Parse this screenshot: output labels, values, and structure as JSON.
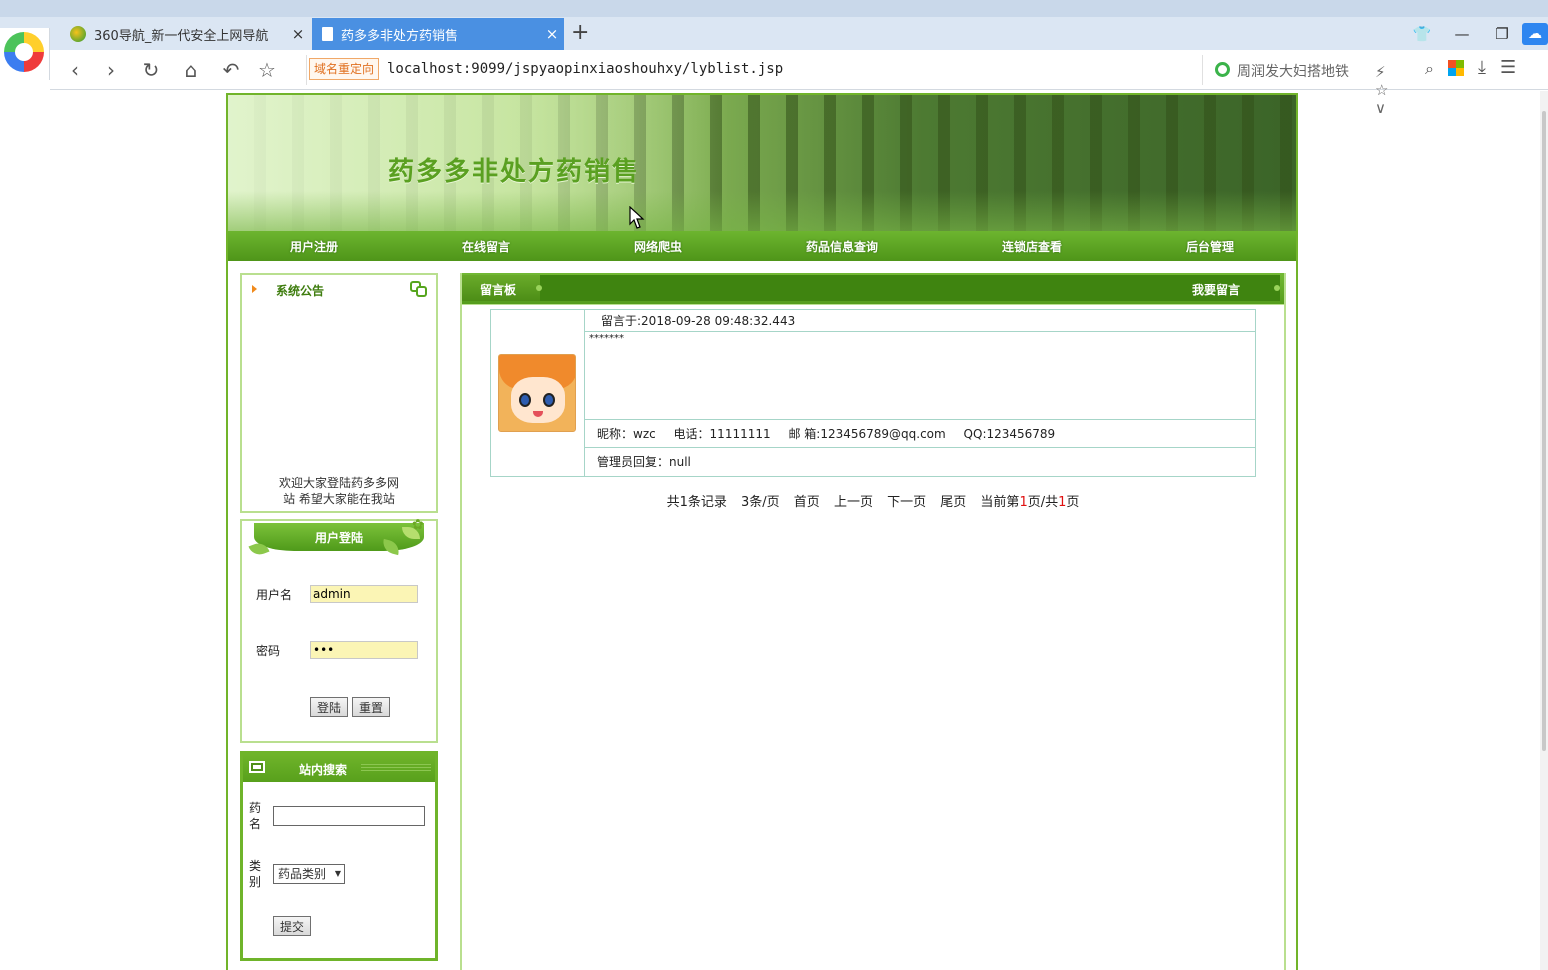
{
  "browser": {
    "tabs": [
      {
        "label": "360导航_新一代安全上网导航",
        "close": "×",
        "active": false
      },
      {
        "label": "药多多非处方药销售",
        "close": "×",
        "active": true
      }
    ],
    "new_tab": "+",
    "redirect_badge": "域名重定向",
    "url": "localhost:9099/jspyaopinxiaoshouhxy/lyblist.jsp",
    "search_placeholder": "周润发大妇搭地铁",
    "icons": [
      "back-icon",
      "forward-icon",
      "refresh-icon",
      "home-icon",
      "undo-icon",
      "star-icon",
      "lightning-icon",
      "dropdown-icon",
      "search-icon",
      "apps-icon",
      "download-icon",
      "menu-icon",
      "shirt-icon",
      "minimize-icon",
      "restore-icon",
      "cloud-icon"
    ]
  },
  "site": {
    "title": "药多多非处方药销售",
    "nav": [
      "用户注册",
      "在线留言",
      "网络爬虫",
      "药品信息查询",
      "连锁店查看",
      "后台管理"
    ]
  },
  "notice": {
    "title": "系统公告",
    "marquee_line1": "欢迎大家登陆药多多网",
    "marquee_line2": "站        希望大家能在我站"
  },
  "login": {
    "title": "用户登陆",
    "username_label": "用户名",
    "username_value": "admin",
    "password_label": "密码",
    "password_value": "•••",
    "login_button": "登陆",
    "reset_button": "重置"
  },
  "search": {
    "title": "站内搜索",
    "name_label": "药名",
    "category_label": "类别",
    "category_selected": "药品类别",
    "submit_button": "提交"
  },
  "board": {
    "title": "留言板",
    "leave_message": "我要留言",
    "message": {
      "posted": "留言于:2018-09-28 09:48:32.443",
      "content": "*******",
      "nickname": "昵称：wzc",
      "phone": "电话：11111111",
      "email": "邮 箱:123456789@qq.com",
      "qq": "QQ:123456789",
      "reply": "管理员回复：null"
    },
    "pager": {
      "total": "共1条记录",
      "per_page": "3条/页",
      "first": "首页",
      "prev": "上一页",
      "next": "下一页",
      "last": "尾页",
      "current_prefix": "当前第",
      "current_page": "1",
      "current_mid": "页/共",
      "total_pages": "1",
      "current_suffix": "页"
    }
  }
}
